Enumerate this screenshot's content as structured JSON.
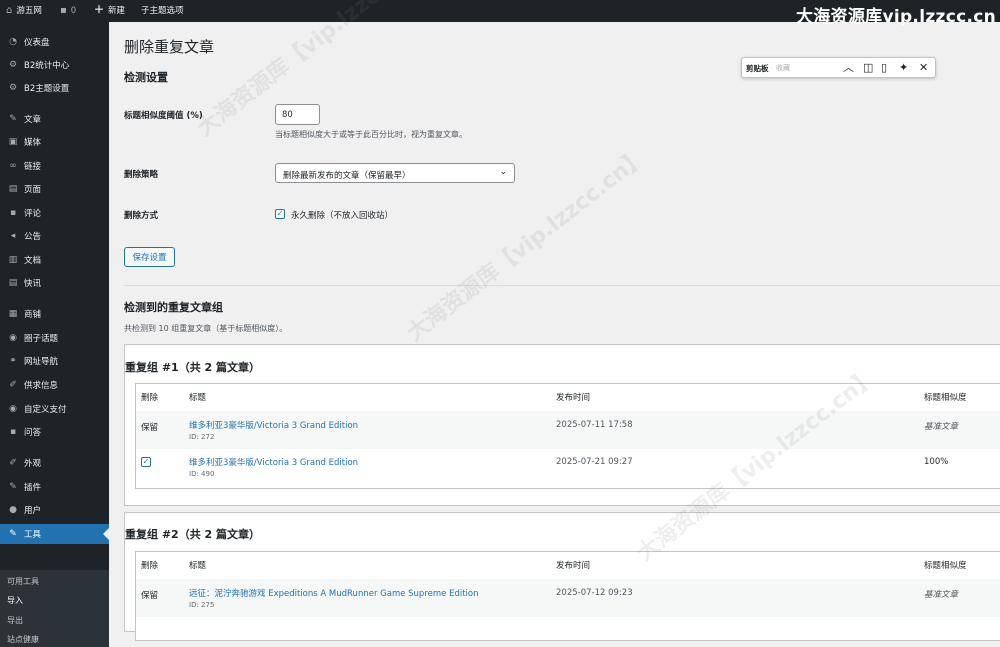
{
  "admin_bar": {
    "site_name": "游五网",
    "comments_count": "0",
    "new_label": "新建",
    "theme_options": "子主题选项",
    "watermark": "大海资源库vip.lzzcc.cn"
  },
  "sidebar": {
    "items": [
      {
        "label": "仪表盘",
        "icon": "dashboard-icon",
        "glyph": "◔"
      },
      {
        "label": "B2统计中心",
        "icon": "gear-icon",
        "glyph": "⚙"
      },
      {
        "label": "B2主题设置",
        "icon": "gear-icon",
        "glyph": "⚙"
      },
      {
        "label": "文章",
        "icon": "pin-icon",
        "glyph": "✎"
      },
      {
        "label": "媒体",
        "icon": "media-icon",
        "glyph": "▣"
      },
      {
        "label": "链接",
        "icon": "link-icon",
        "glyph": "∞"
      },
      {
        "label": "页面",
        "icon": "page-icon",
        "glyph": "▤"
      },
      {
        "label": "评论",
        "icon": "comment-icon",
        "glyph": "▪"
      },
      {
        "label": "公告",
        "icon": "megaphone-icon",
        "glyph": "◂"
      },
      {
        "label": "文档",
        "icon": "document-icon",
        "glyph": "▥"
      },
      {
        "label": "快讯",
        "icon": "news-icon",
        "glyph": "▤"
      },
      {
        "label": "商铺",
        "icon": "shop-icon",
        "glyph": "▦"
      },
      {
        "label": "圈子话题",
        "icon": "circle-icon",
        "glyph": "◉"
      },
      {
        "label": "网址导航",
        "icon": "network-icon",
        "glyph": "⚭"
      },
      {
        "label": "供求信息",
        "icon": "info-icon",
        "glyph": "✐"
      },
      {
        "label": "自定义支付",
        "icon": "payment-icon",
        "glyph": "◉"
      },
      {
        "label": "问答",
        "icon": "qa-icon",
        "glyph": "▪"
      },
      {
        "label": "外观",
        "icon": "appearance-icon",
        "glyph": "✐"
      },
      {
        "label": "插件",
        "icon": "plugin-icon",
        "glyph": "✎"
      },
      {
        "label": "用户",
        "icon": "user-icon",
        "glyph": "●"
      },
      {
        "label": "工具",
        "icon": "wrench-icon",
        "glyph": "✎"
      }
    ],
    "submenu": [
      "可用工具",
      "导入",
      "导出",
      "站点健康"
    ]
  },
  "page": {
    "title": "删除重复文章",
    "detect_settings_title": "检测设置",
    "threshold_label": "标题相似度阈值 (%)",
    "threshold_value": "80",
    "threshold_desc": "当标题相似度大于或等于此百分比时，视为重复文章。",
    "strategy_label": "删除策略",
    "strategy_value": "删除最新发布的文章（保留最早）",
    "method_label": "删除方式",
    "method_checkbox_label": "永久删除（不放入回收站）",
    "save_button": "保存设置",
    "groups_title": "检测到的重复文章组",
    "groups_summary": "共检测到 10 组重复文章（基于标题相似度）。"
  },
  "table_headers": {
    "delete": "删除",
    "title": "标题",
    "date": "发布时间",
    "similarity": "标题相似度"
  },
  "groups": [
    {
      "title": "重复组 #1（共 2 篇文章）",
      "rows": [
        {
          "action": "保留",
          "title": "维多利亚3豪华版/Victoria 3 Grand Edition",
          "id": "ID: 272",
          "date": "2025-07-11 17:58",
          "similarity": "基准文章"
        },
        {
          "action": "",
          "title": "维多利亚3豪华版/Victoria 3 Grand Edition",
          "id": "ID: 490",
          "date": "2025-07-21 09:27",
          "similarity": "100%"
        }
      ]
    },
    {
      "title": "重复组 #2（共 2 篇文章）",
      "rows": [
        {
          "action": "保留",
          "title": "远征：泥泞奔驰游戏 Expeditions A MudRunner Game Supreme Edition",
          "id": "ID: 275",
          "date": "2025-07-12 09:23",
          "similarity": "基准文章"
        }
      ]
    }
  ],
  "clipboard_widget": {
    "title": "剪贴板",
    "placeholder": "收藏"
  },
  "watermark_text": "大海资源库【vip.lzzcc.cn】",
  "colors": {
    "admin_bar_bg": "#1d2327",
    "accent": "#2271b1",
    "content_bg": "#f0f0f1"
  }
}
